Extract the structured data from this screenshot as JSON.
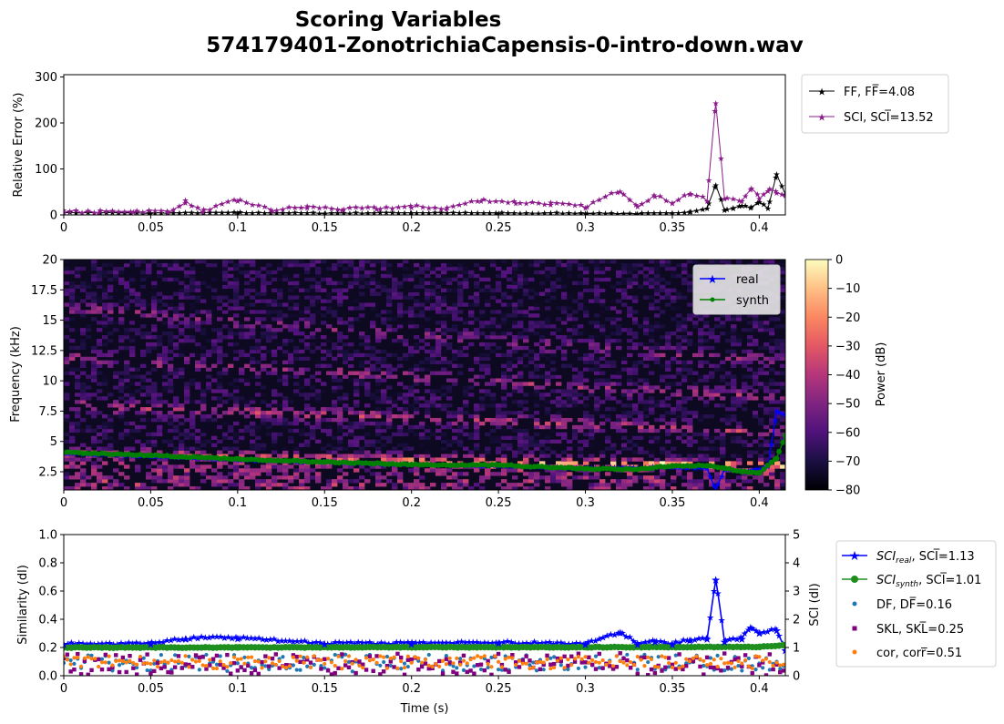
{
  "figure": {
    "title_line1": "Scoring Variables",
    "title_line2": "574179401-ZonotrichiaCapensis-0-intro-down.wav"
  },
  "chart_data": [
    {
      "type": "line",
      "panel": "relative-error",
      "ylabel": "Relative Error (%)",
      "xlim": [
        0,
        0.415
      ],
      "ylim": [
        0,
        305
      ],
      "x_ticks": [
        "0",
        "0.05",
        "0.1",
        "0.15",
        "0.2",
        "0.25",
        "0.3",
        "0.35",
        "0.4"
      ],
      "y_ticks": [
        "0",
        "100",
        "200",
        "300"
      ],
      "legend_position": "outside-right",
      "series": [
        {
          "name": "FF, FF̅=4.08",
          "color": "#000000",
          "marker": "star",
          "points": [
            [
              0,
              4
            ],
            [
              0.05,
              3
            ],
            [
              0.1,
              4
            ],
            [
              0.15,
              3
            ],
            [
              0.2,
              4
            ],
            [
              0.25,
              3
            ],
            [
              0.3,
              3
            ],
            [
              0.33,
              2
            ],
            [
              0.35,
              3
            ],
            [
              0.36,
              6
            ],
            [
              0.37,
              14
            ],
            [
              0.375,
              65
            ],
            [
              0.38,
              10
            ],
            [
              0.385,
              14
            ],
            [
              0.39,
              20
            ],
            [
              0.395,
              15
            ],
            [
              0.4,
              28
            ],
            [
              0.405,
              14
            ],
            [
              0.41,
              88
            ],
            [
              0.415,
              45
            ]
          ]
        },
        {
          "name": "SCI, SCI̅=13.52",
          "color": "#8b1a8b",
          "marker": "star",
          "points": [
            [
              0,
              5
            ],
            [
              0.02,
              4
            ],
            [
              0.04,
              6
            ],
            [
              0.06,
              5
            ],
            [
              0.07,
              26
            ],
            [
              0.08,
              6
            ],
            [
              0.1,
              30
            ],
            [
              0.12,
              8
            ],
            [
              0.14,
              15
            ],
            [
              0.16,
              10
            ],
            [
              0.18,
              12
            ],
            [
              0.2,
              16
            ],
            [
              0.22,
              12
            ],
            [
              0.24,
              30
            ],
            [
              0.26,
              25
            ],
            [
              0.28,
              22
            ],
            [
              0.3,
              15
            ],
            [
              0.32,
              51
            ],
            [
              0.33,
              18
            ],
            [
              0.34,
              40
            ],
            [
              0.35,
              25
            ],
            [
              0.36,
              45
            ],
            [
              0.37,
              30
            ],
            [
              0.375,
              243
            ],
            [
              0.38,
              35
            ],
            [
              0.39,
              30
            ],
            [
              0.395,
              55
            ],
            [
              0.4,
              35
            ],
            [
              0.405,
              52
            ],
            [
              0.41,
              48
            ],
            [
              0.415,
              42
            ]
          ]
        }
      ]
    },
    {
      "type": "heatmap",
      "panel": "spectrogram",
      "ylabel": "Frequency (kHz)",
      "xlim": [
        0,
        0.415
      ],
      "ylim": [
        1,
        20
      ],
      "x_ticks": [
        "0",
        "0.05",
        "0.1",
        "0.15",
        "0.2",
        "0.25",
        "0.3",
        "0.35",
        "0.4"
      ],
      "y_ticks": [
        "2.5",
        "5",
        "7.5",
        "10",
        "12.5",
        "15",
        "17.5",
        "20"
      ],
      "colormap": "magma",
      "colorbar": {
        "label": "Power (dB)",
        "range": [
          -80,
          0
        ],
        "ticks": [
          "0",
          "−10",
          "−20",
          "−30",
          "−40",
          "−50",
          "−60",
          "−70",
          "−80"
        ]
      },
      "harmonics_khz_start_end": [
        [
          4.0,
          3.0
        ],
        [
          8.0,
          5.8
        ],
        [
          12.0,
          8.6
        ],
        [
          16.0,
          11.5
        ]
      ],
      "legend_position": "upper-right",
      "series": [
        {
          "name": "real",
          "color": "#0000ff",
          "marker": "star",
          "points": [
            [
              0,
              4.0
            ],
            [
              0.05,
              3.8
            ],
            [
              0.1,
              3.5
            ],
            [
              0.15,
              3.3
            ],
            [
              0.2,
              3.1
            ],
            [
              0.25,
              3.0
            ],
            [
              0.3,
              2.8
            ],
            [
              0.35,
              2.9
            ],
            [
              0.37,
              2.8
            ],
            [
              0.375,
              1.0
            ],
            [
              0.38,
              2.7
            ],
            [
              0.39,
              2.6
            ],
            [
              0.4,
              2.7
            ],
            [
              0.405,
              3.0
            ],
            [
              0.41,
              7.5
            ],
            [
              0.415,
              7.2
            ]
          ]
        },
        {
          "name": "synth",
          "color": "#008000",
          "marker": "dot",
          "points": [
            [
              0,
              4.1
            ],
            [
              0.05,
              3.85
            ],
            [
              0.1,
              3.55
            ],
            [
              0.15,
              3.3
            ],
            [
              0.2,
              3.1
            ],
            [
              0.25,
              3.05
            ],
            [
              0.3,
              2.75
            ],
            [
              0.33,
              2.7
            ],
            [
              0.35,
              3.0
            ],
            [
              0.37,
              3.0
            ],
            [
              0.38,
              2.8
            ],
            [
              0.39,
              2.5
            ],
            [
              0.4,
              2.4
            ],
            [
              0.41,
              3.6
            ],
            [
              0.415,
              5.5
            ]
          ]
        }
      ]
    },
    {
      "type": "line",
      "panel": "similarity",
      "ylabel": "Similarity (dl)",
      "y2label": "SCI (dl)",
      "xlabel": "Time (s)",
      "xlim": [
        0,
        0.415
      ],
      "ylim": [
        0,
        1.0
      ],
      "y2lim": [
        0,
        5
      ],
      "x_ticks": [
        "0",
        "0.05",
        "0.1",
        "0.15",
        "0.2",
        "0.25",
        "0.3",
        "0.35",
        "0.4"
      ],
      "y_ticks": [
        "0.0",
        "0.2",
        "0.4",
        "0.6",
        "0.8",
        "1.0"
      ],
      "y2_ticks": [
        "0",
        "1",
        "2",
        "3",
        "4",
        "5"
      ],
      "legend_position": "outside-right",
      "series": [
        {
          "name_base": "SCI",
          "name_sub": "real",
          "name_value": "SCI̅=1.13",
          "color": "#0000ff",
          "marker": "star",
          "axis": "right",
          "points": [
            [
              0,
              1.1
            ],
            [
              0.05,
              1.12
            ],
            [
              0.07,
              1.3
            ],
            [
              0.1,
              1.32
            ],
            [
              0.15,
              1.12
            ],
            [
              0.2,
              1.12
            ],
            [
              0.25,
              1.15
            ],
            [
              0.3,
              1.1
            ],
            [
              0.32,
              1.52
            ],
            [
              0.33,
              1.1
            ],
            [
              0.34,
              1.2
            ],
            [
              0.35,
              1.1
            ],
            [
              0.36,
              1.25
            ],
            [
              0.37,
              1.3
            ],
            [
              0.375,
              3.4
            ],
            [
              0.38,
              1.2
            ],
            [
              0.39,
              1.3
            ],
            [
              0.395,
              1.7
            ],
            [
              0.4,
              1.5
            ],
            [
              0.41,
              1.6
            ],
            [
              0.415,
              0.9
            ]
          ]
        },
        {
          "name_base": "SCI",
          "name_sub": "synth",
          "name_value": "SCI̅=1.01",
          "color": "#1e8f1e",
          "marker": "dot",
          "axis": "right",
          "points": [
            [
              0,
              1.0
            ],
            [
              0.1,
              1.0
            ],
            [
              0.2,
              1.01
            ],
            [
              0.3,
              1.01
            ],
            [
              0.4,
              1.02
            ],
            [
              0.415,
              1.08
            ]
          ]
        },
        {
          "name": "DF, DF̅=0.16",
          "color": "#1f77b4",
          "marker": "dot-scatter",
          "axis": "left",
          "range": [
            0.03,
            0.15
          ]
        },
        {
          "name": "SKL, SKL̅=0.25",
          "color": "#800080",
          "marker": "square-scatter",
          "axis": "left",
          "range": [
            0.0,
            0.16
          ]
        },
        {
          "name": "cor, corr̅=0.51",
          "color": "#ff7f0e",
          "marker": "dot-scatter",
          "axis": "left",
          "range": [
            0.05,
            0.14
          ]
        }
      ]
    }
  ]
}
